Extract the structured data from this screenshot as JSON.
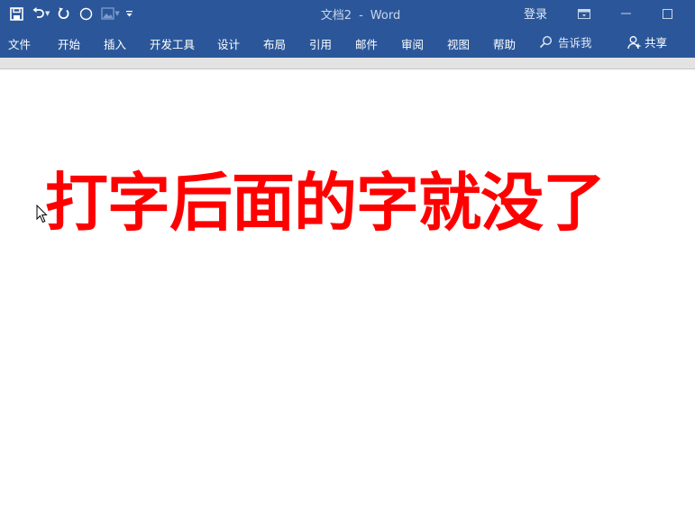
{
  "window": {
    "document_name": "文档2",
    "separator": "-",
    "app_name": "Word",
    "signin_label": "登录"
  },
  "quick_access": {
    "icons": [
      "save-icon",
      "undo-icon",
      "redo-icon",
      "circle-icon",
      "image-icon",
      "customize-icon"
    ]
  },
  "ribbon": {
    "tabs": [
      "文件",
      "开始",
      "插入",
      "开发工具",
      "设计",
      "布局",
      "引用",
      "邮件",
      "审阅",
      "视图",
      "帮助"
    ],
    "tell_me_label": "告诉我",
    "share_label": "共享"
  },
  "document": {
    "text": "打字后面的字就没了",
    "text_color": "#ff0000"
  },
  "colors": {
    "title_bar": "#2b579a",
    "ruler": "#e3e3e3",
    "page": "#ffffff"
  }
}
